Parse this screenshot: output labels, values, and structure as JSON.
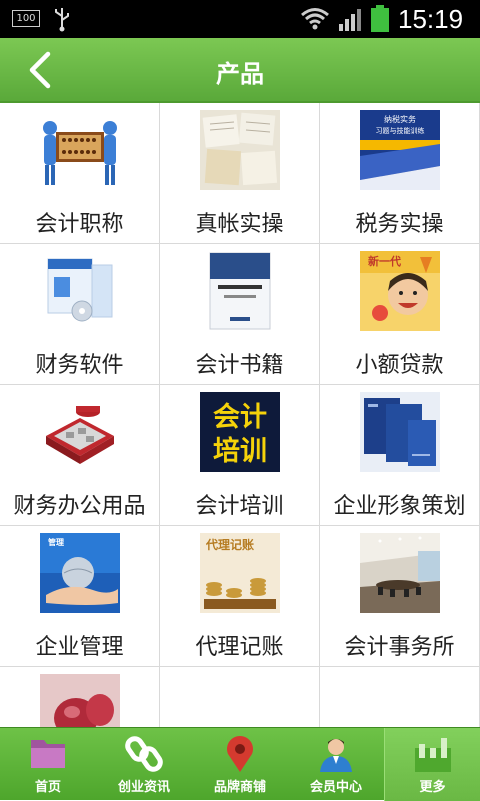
{
  "status_bar": {
    "battery_left": "100",
    "time": "15:19"
  },
  "header": {
    "title": "产品"
  },
  "products": [
    {
      "label": "会计职称",
      "icon": "abacus-people-image"
    },
    {
      "label": "真帐实操",
      "icon": "account-books-image"
    },
    {
      "label": "税务实操",
      "icon": "tax-book-cover-image",
      "thumb_text": "纳税实务\n习题与技能训练"
    },
    {
      "label": "财务软件",
      "icon": "software-box-image"
    },
    {
      "label": "会计书籍",
      "icon": "accounting-book-image"
    },
    {
      "label": "小额贷款",
      "icon": "loan-child-image",
      "thumb_text": "新一代"
    },
    {
      "label": "财务办公用品",
      "icon": "office-supplies-image"
    },
    {
      "label": "会计培训",
      "icon": "training-sign-image",
      "thumb_text": "会计\n培训"
    },
    {
      "label": "企业形象策划",
      "icon": "brand-folders-image"
    },
    {
      "label": "企业管理",
      "icon": "globe-hand-image",
      "thumb_text": "管理"
    },
    {
      "label": "代理记账",
      "icon": "bookkeeping-coins-image",
      "thumb_text": "代理记账"
    },
    {
      "label": "会计事务所",
      "icon": "meeting-room-image"
    },
    {
      "label": "",
      "icon": "red-seal-image"
    },
    {
      "label": "",
      "icon": ""
    },
    {
      "label": "",
      "icon": ""
    }
  ],
  "bottom_nav": [
    {
      "label": "首页",
      "icon": "folder-icon"
    },
    {
      "label": "创业资讯",
      "icon": "link-icon"
    },
    {
      "label": "品牌商铺",
      "icon": "map-pin-icon"
    },
    {
      "label": "会员中心",
      "icon": "member-icon"
    },
    {
      "label": "更多",
      "icon": "more-icon",
      "active": true
    }
  ],
  "colors": {
    "header_green": "#6cbb45",
    "nav_green": "#5cb338"
  }
}
